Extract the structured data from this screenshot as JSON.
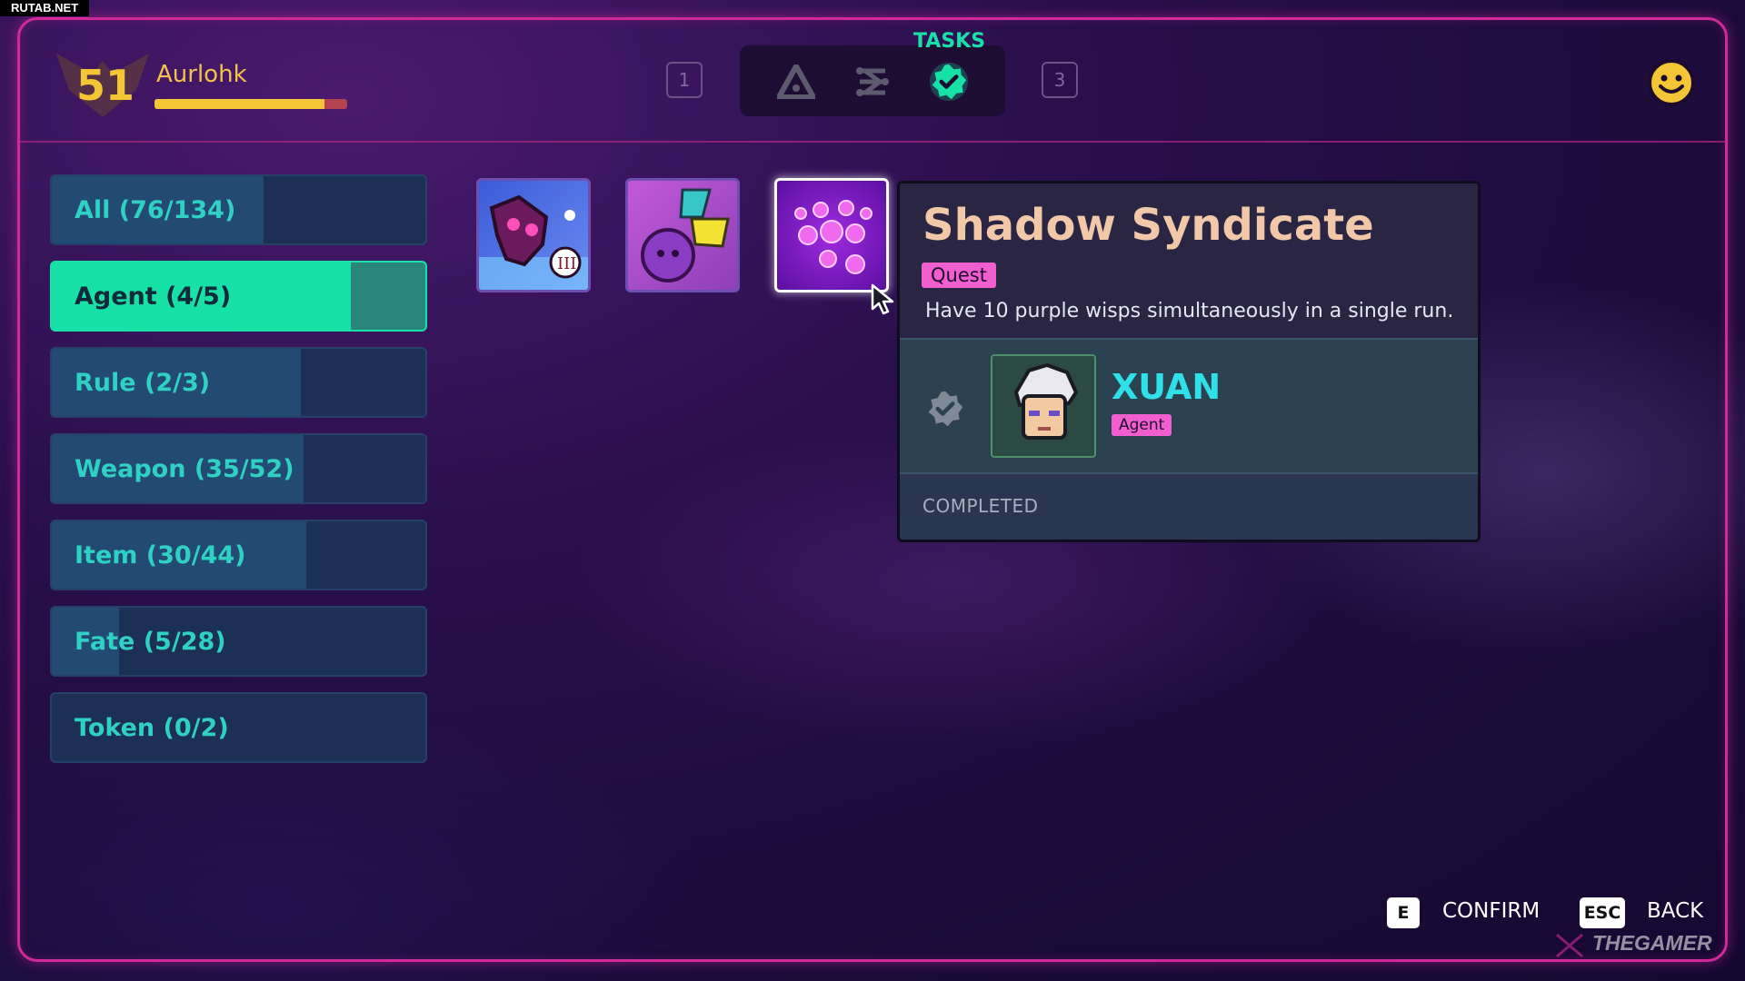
{
  "watermark": "RUTAB.NET",
  "player": {
    "level": "51",
    "name": "Aurlohk",
    "xp_progress": 0.88
  },
  "tabs": {
    "left_num": "1",
    "right_num": "3",
    "active_label": "TASKS",
    "icons": [
      "triangle-warning-icon",
      "nodes-icon",
      "verified-check-icon"
    ]
  },
  "categories": [
    {
      "label": "All (76/134)",
      "progress": 0.567,
      "active": false
    },
    {
      "label": "Agent (4/5)",
      "progress": 0.8,
      "active": true
    },
    {
      "label": "Rule (2/3)",
      "progress": 0.667,
      "active": false
    },
    {
      "label": "Weapon (35/52)",
      "progress": 0.673,
      "active": false
    },
    {
      "label": "Item (30/44)",
      "progress": 0.682,
      "active": false
    },
    {
      "label": "Fate (5/28)",
      "progress": 0.179,
      "active": false
    },
    {
      "label": "Token (0/2)",
      "progress": 0.0,
      "active": false
    }
  ],
  "tooltip": {
    "title": "Shadow Syndicate",
    "badge": "Quest",
    "description": "Have 10 purple wisps simultaneously in a single run.",
    "agent_name": "XUAN",
    "agent_badge": "Agent",
    "status": "COMPLETED"
  },
  "footer": {
    "confirm_key": "E",
    "confirm_label": "CONFIRM",
    "back_key": "ESC",
    "back_label": "BACK",
    "brand": "THEGAMER"
  },
  "colors": {
    "accent": "#17e1a6",
    "frame": "#d02a9a",
    "badge": "#f05ecf",
    "level": "#f4c534"
  }
}
